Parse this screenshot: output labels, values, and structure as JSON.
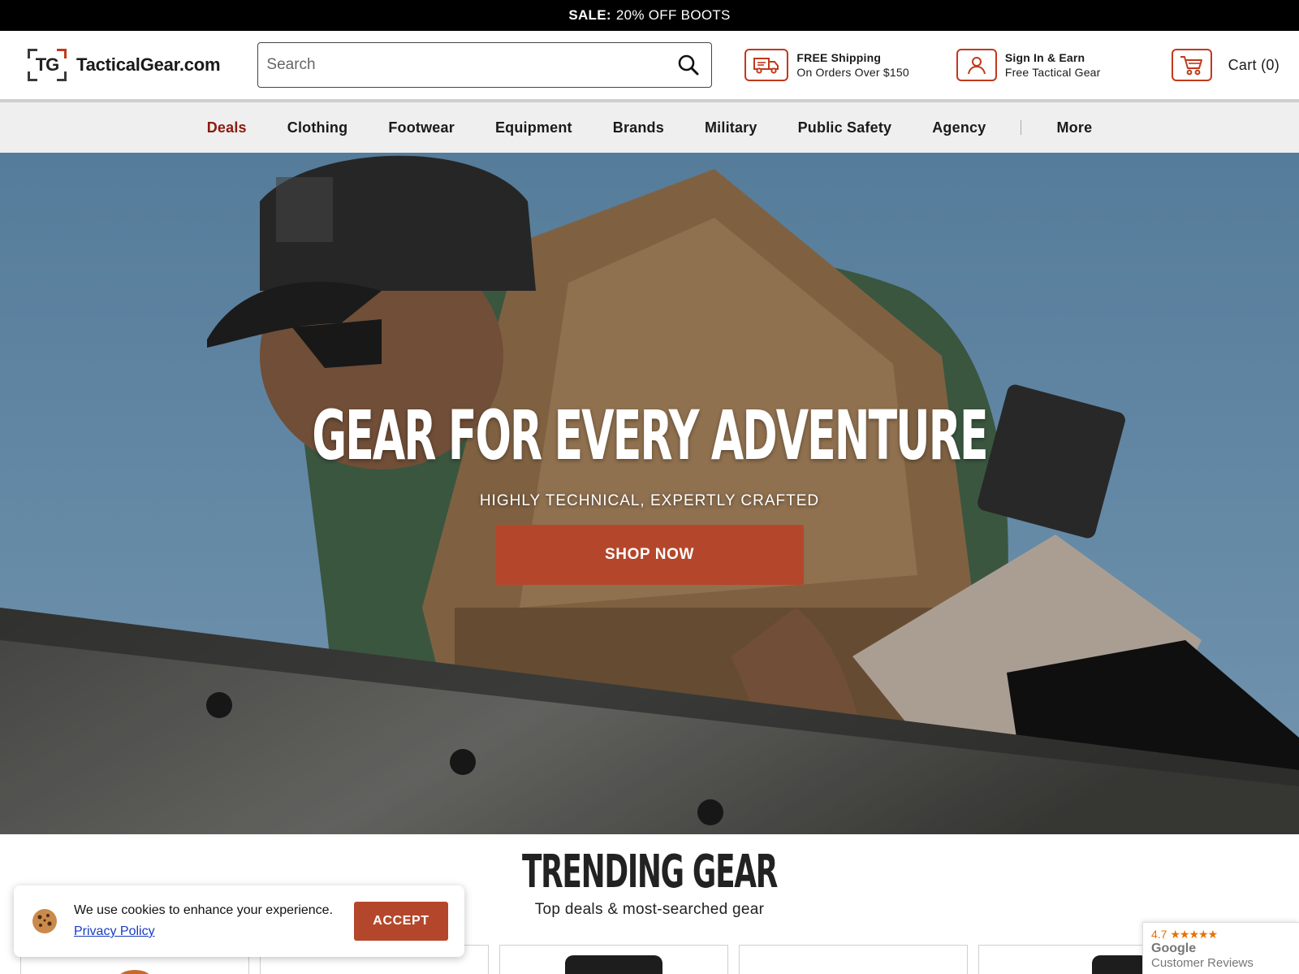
{
  "promo": {
    "prefix": "SALE:",
    "text": "20% OFF BOOTS"
  },
  "header": {
    "logo_mark": "TG",
    "logo_text": "TacticalGear.com",
    "search_placeholder": "Search",
    "shipping": {
      "line1": "FREE Shipping",
      "line2": "On Orders Over $150"
    },
    "account": {
      "line1": "Sign In & Earn",
      "line2": "Free Tactical Gear"
    },
    "cart_label": "Cart (0)"
  },
  "nav": {
    "items": [
      "Deals",
      "Clothing",
      "Footwear",
      "Equipment",
      "Brands",
      "Military",
      "Public Safety",
      "Agency"
    ],
    "more": "More"
  },
  "hero": {
    "title": "GEAR FOR EVERY ADVENTURE",
    "subtitle": "HIGHLY TECHNICAL, EXPERTLY CRAFTED",
    "button": "SHOP NOW"
  },
  "trending": {
    "title": "TRENDING GEAR",
    "subtitle": "Top deals & most-searched gear"
  },
  "cookie": {
    "text": "We use cookies to enhance your experience.",
    "link": "Privacy Policy",
    "button": "ACCEPT"
  },
  "google_reviews": {
    "rating": "4.7",
    "stars": "★★★★★",
    "brand": "Google",
    "label": "Customer Reviews"
  },
  "colors": {
    "accent": "#b4472b",
    "deals": "#8b1a10",
    "icon_border": "#c0391b"
  }
}
